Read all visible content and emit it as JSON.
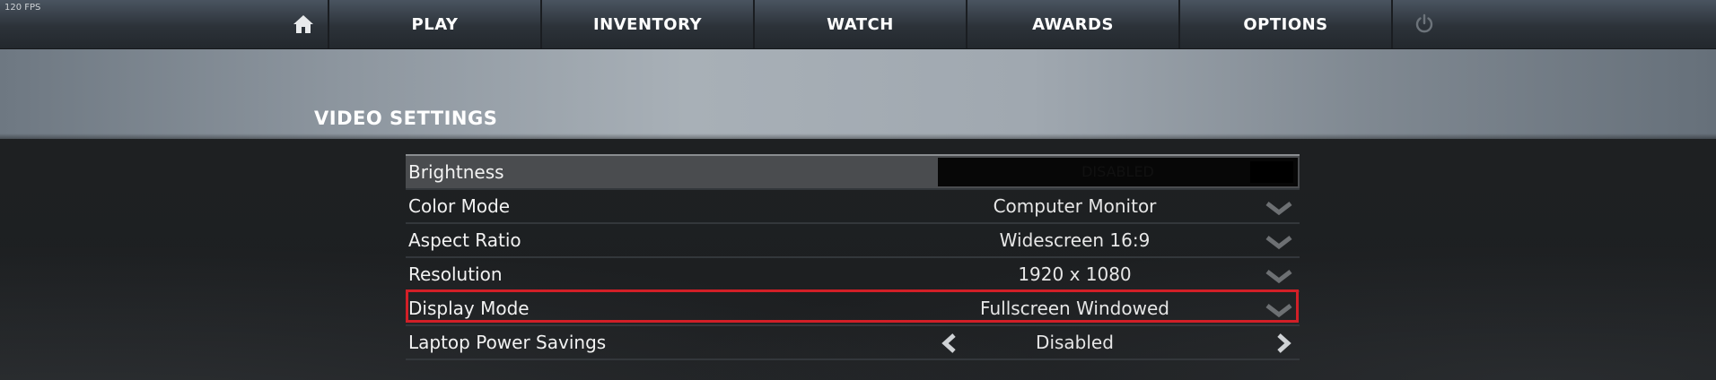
{
  "fps": "120 FPS",
  "nav": {
    "home_icon": "home-icon",
    "items": [
      {
        "label": "PLAY"
      },
      {
        "label": "INVENTORY"
      },
      {
        "label": "WATCH"
      },
      {
        "label": "AWARDS"
      },
      {
        "label": "OPTIONS"
      }
    ],
    "power_icon": "power-icon"
  },
  "section": {
    "title": "VIDEO SETTINGS"
  },
  "settings": [
    {
      "label": "Brightness",
      "value": "DISABLED",
      "control": "slider"
    },
    {
      "label": "Color Mode",
      "value": "Computer Monitor",
      "control": "dropdown"
    },
    {
      "label": "Aspect Ratio",
      "value": "Widescreen 16:9",
      "control": "dropdown"
    },
    {
      "label": "Resolution",
      "value": "1920 x 1080",
      "control": "dropdown"
    },
    {
      "label": "Display Mode",
      "value": "Fullscreen Windowed",
      "control": "dropdown",
      "highlighted": true
    },
    {
      "label": "Laptop Power Savings",
      "value": "Disabled",
      "control": "arrows"
    }
  ],
  "colors": {
    "highlight": "#d21f27",
    "text": "#f2f2f2"
  }
}
